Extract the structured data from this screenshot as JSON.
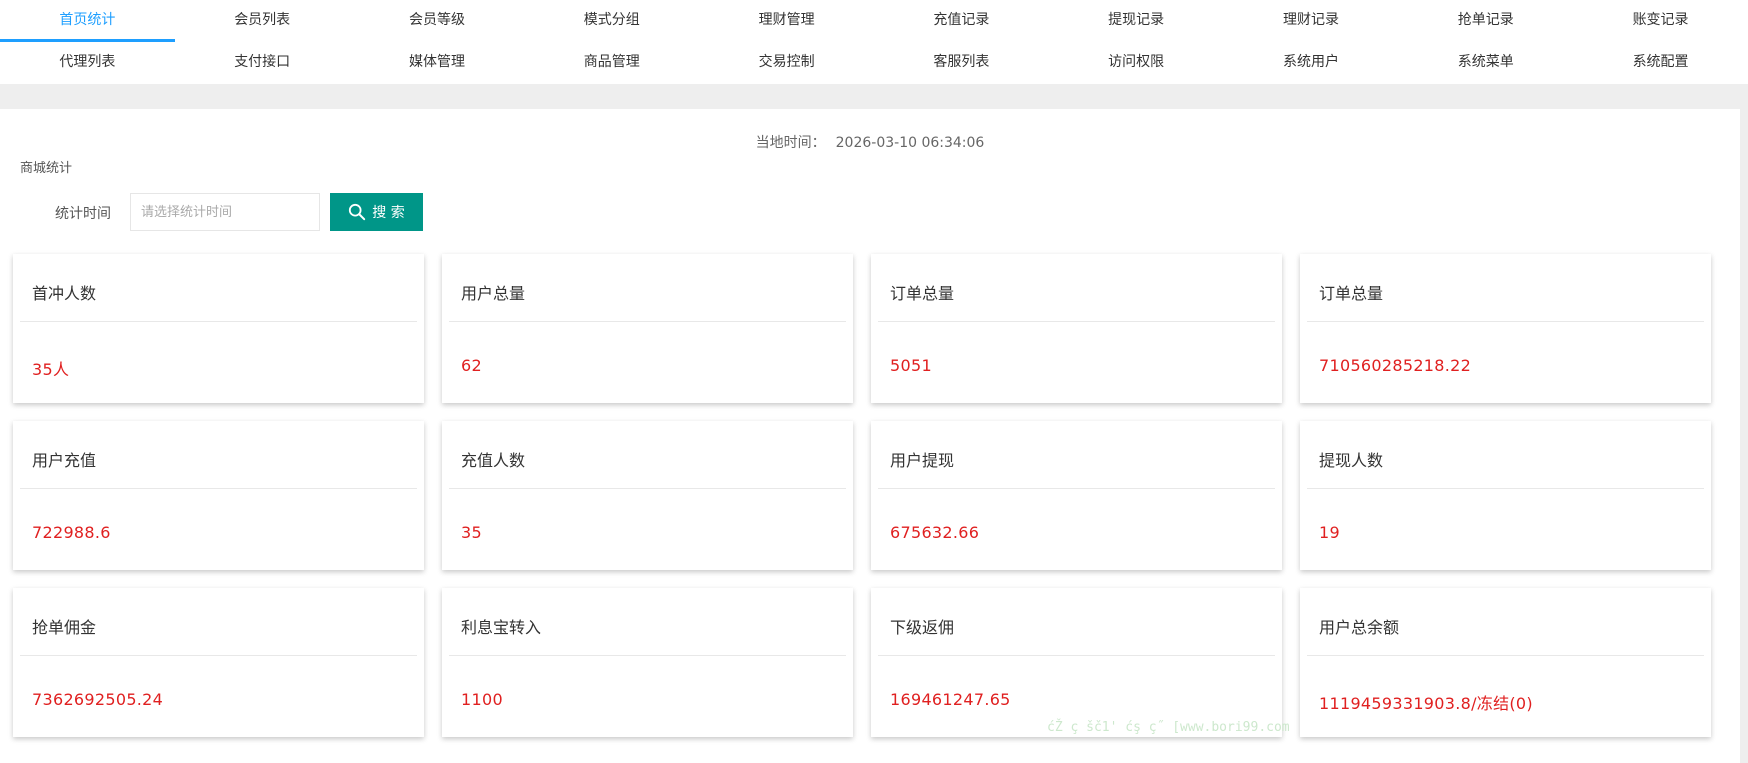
{
  "nav": {
    "row1": [
      "首页统计",
      "会员列表",
      "会员等级",
      "模式分组",
      "理财管理",
      "充值记录",
      "提现记录",
      "理财记录",
      "抢单记录",
      "账变记录"
    ],
    "row2": [
      "代理列表",
      "支付接口",
      "媒体管理",
      "商品管理",
      "交易控制",
      "客服列表",
      "访问权限",
      "系统用户",
      "系统菜单",
      "系统配置"
    ],
    "active": "首页统计"
  },
  "time": {
    "label": "当地时间：",
    "value": "2026-03-10 06:34:06"
  },
  "section": {
    "title": "商城统计"
  },
  "filter": {
    "label": "统计时间",
    "placeholder": "请选择统计时间",
    "search_label": "搜 索",
    "accent": "#009688"
  },
  "stats": [
    {
      "title": "首冲人数",
      "value": "35人"
    },
    {
      "title": "用户总量",
      "value": "62"
    },
    {
      "title": "订单总量",
      "value": "5051"
    },
    {
      "title": "订单总量",
      "value": "710560285218.22"
    },
    {
      "title": "用户充值",
      "value": "722988.6"
    },
    {
      "title": "充值人数",
      "value": "35"
    },
    {
      "title": "用户提现",
      "value": "675632.66"
    },
    {
      "title": "提现人数",
      "value": "19"
    },
    {
      "title": "抢单佣金",
      "value": "7362692505.24"
    },
    {
      "title": "利息宝转入",
      "value": "1100"
    },
    {
      "title": "下级返佣",
      "value": "169461247.65"
    },
    {
      "title": "用户总余额",
      "value": "1119459331903.8/冻结(0)"
    }
  ],
  "watermark": "ćŽ ç šč1' ćş ç˝ [www.bori99.com",
  "colors": {
    "nav_active": "#1e9fff",
    "value_red": "#e02020",
    "band_gray": "#eeeeee"
  }
}
